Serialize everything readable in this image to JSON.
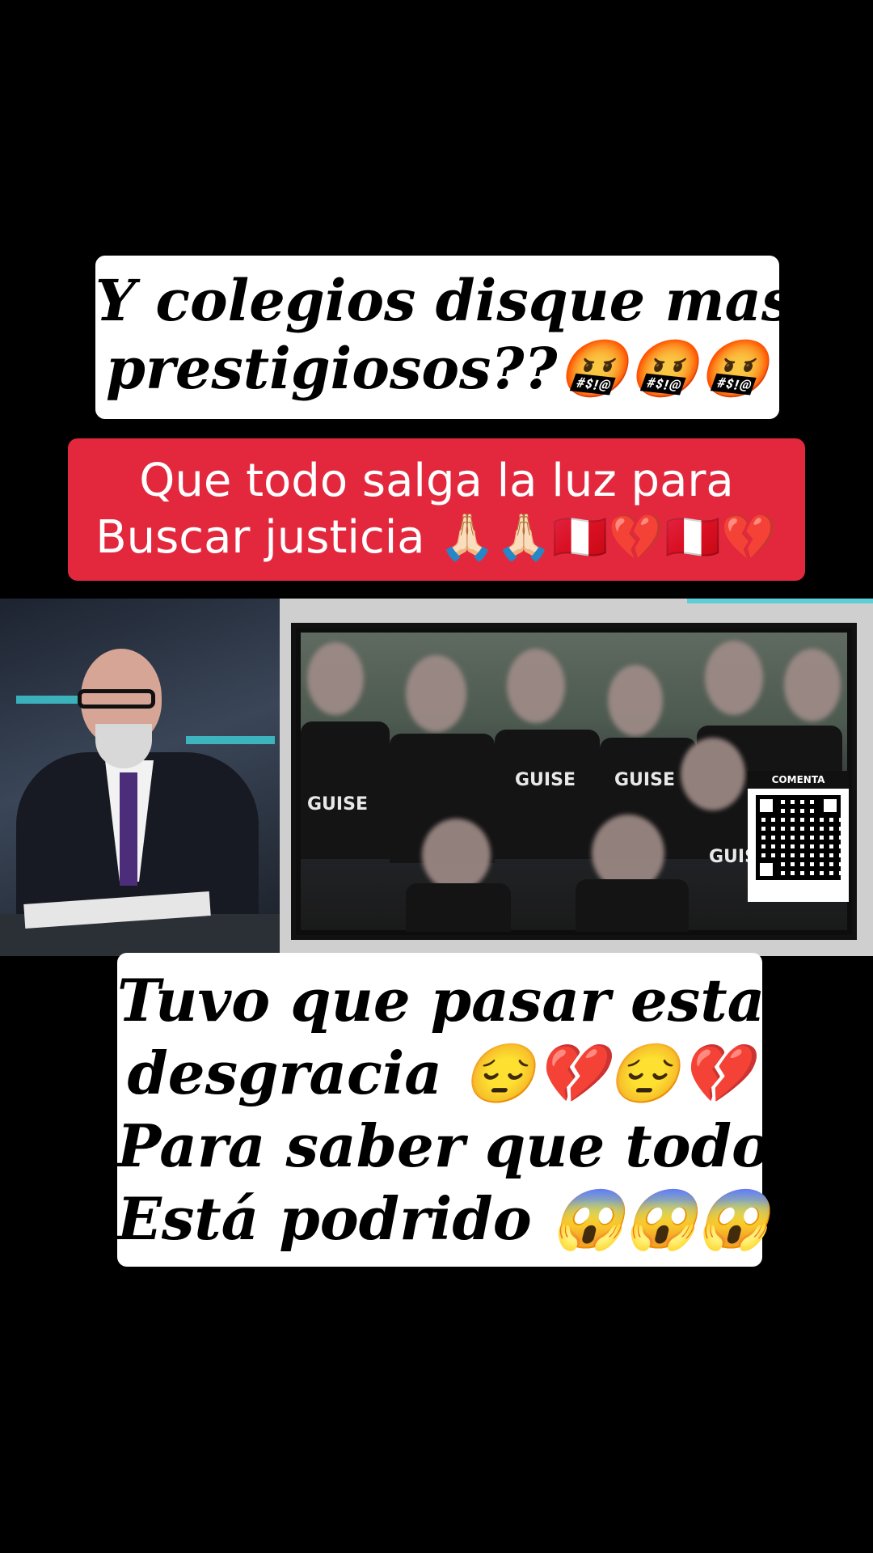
{
  "captions": {
    "top": {
      "lines": [
        "Y colegios disque mas",
        "prestigiosos??🤬🤬🤬"
      ]
    },
    "middle": {
      "lines": [
        "Que todo salga la luz para",
        "Buscar justicia 🙏🏻🙏🏻🇵🇪💔🇵🇪💔"
      ]
    },
    "bottom": {
      "lines": [
        "Tuvo que pasar esta",
        "desgracia 😔💔😔💔",
        "Para saber que todo",
        "Está podrido 😱😱😱"
      ]
    }
  },
  "video": {
    "shirt_text": [
      "GUISE",
      "GUISE",
      "GUISE",
      "GUISE"
    ],
    "qr_label": "COMENTA"
  },
  "colors": {
    "caption_red": "#e3283e",
    "caption_white": "#ffffff",
    "background": "#000000"
  }
}
